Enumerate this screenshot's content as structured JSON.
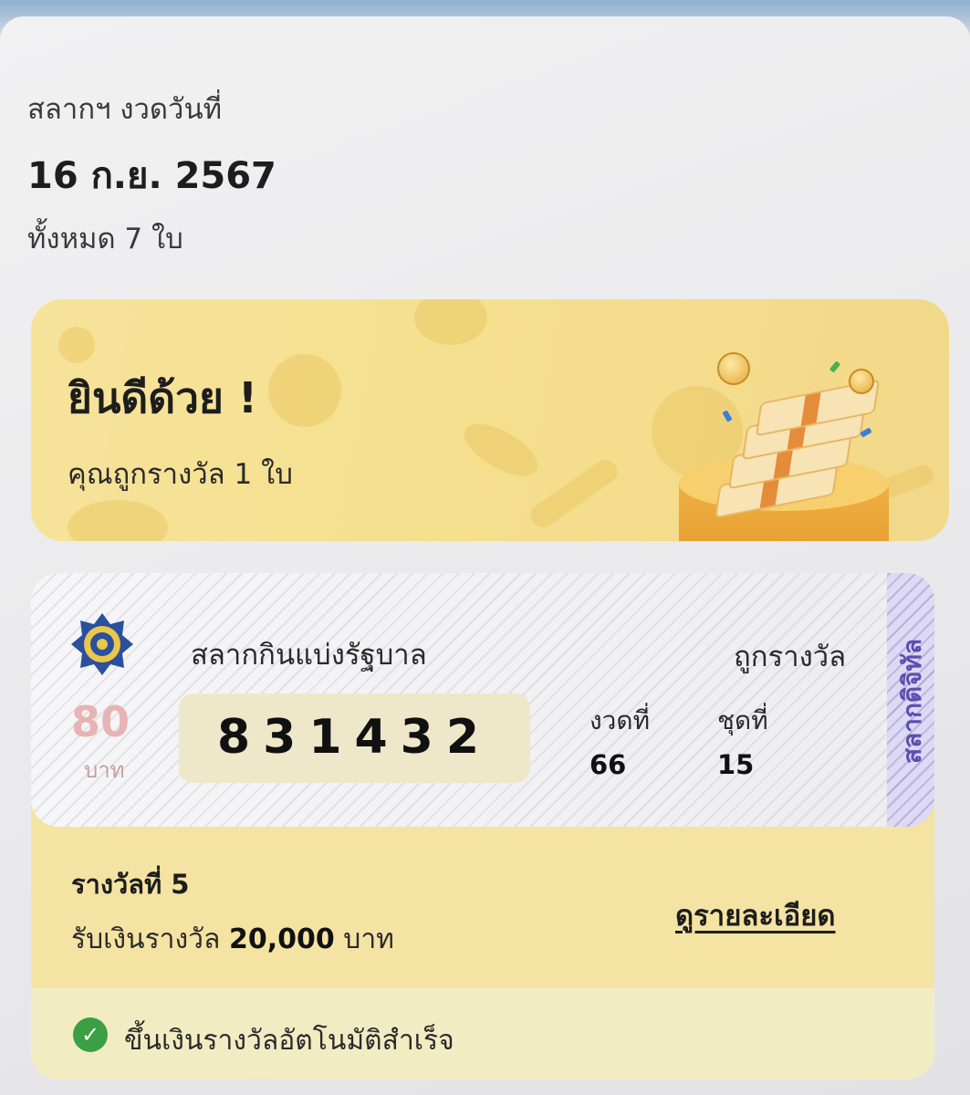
{
  "header": {
    "label": "สลากฯ งวดวันที่",
    "date": "16 ก.ย. 2567",
    "count": "ทั้งหมด 7 ใบ"
  },
  "banner": {
    "title": "ยินดีด้วย !",
    "subtitle": "คุณถูกรางวัล 1 ใบ"
  },
  "ticket": {
    "name": "สลากกินแบ่งรัฐบาล",
    "status": "ถูกรางวัล",
    "price": "80",
    "price_unit": "บาท",
    "number": "831432",
    "draw_label": "งวดที่",
    "draw_value": "66",
    "set_label": "ชุดที่",
    "set_value": "15",
    "side_label": "สลากดิจิทัล"
  },
  "prize": {
    "title": "รางวัลที่ 5",
    "amount_prefix": "รับเงินรางวัล",
    "amount": "20,000",
    "amount_unit": "บาท",
    "details_link": "ดูรายละเอียด"
  },
  "status": {
    "text": "ขึ้นเงินรางวัลอัตโนมัติสำเร็จ"
  },
  "colors": {
    "banner": "#f5e08f",
    "prize_box": "#f4e3a2",
    "check": "#3aa043",
    "side_label": "#5a4fb0"
  },
  "icons": {
    "emblem": "lottery-office-emblem",
    "status": "check-circle-icon"
  }
}
